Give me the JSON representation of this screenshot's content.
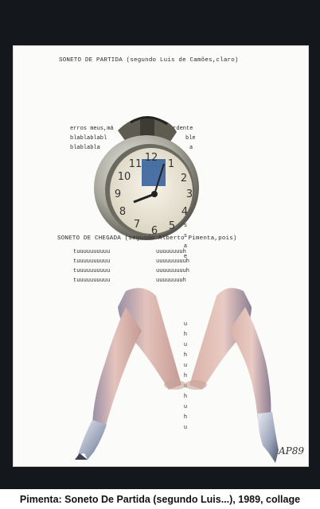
{
  "caption": "Pimenta: Soneto De Partida (segundo Luis...), 1989, collage",
  "poem_top": {
    "title": "SONETO DE PARTIDA (segundo Luis de Camões,claro)",
    "lines": [
      "erros meus,má",
      "blablablabl",
      "blablabla"
    ],
    "right_fragments": [
      "ardente",
      "ble",
      "a"
    ],
    "column": [
      "s",
      "s",
      "a",
      "e",
      "s",
      "a",
      "s"
    ]
  },
  "poem_bottom": {
    "title": "SONETO DE CHEGADA (segundo Alberto Pimenta,pois)",
    "lines": [
      "tuuuuuuuuuu",
      "tuuuuuuuuuu",
      "tuuuuuuuuuu",
      "tuuuuuuuuuu"
    ],
    "right_lines": [
      "uuuuuuuuh",
      "uuuuuuuuuh",
      "uuuuuuuuuh",
      "uuuuuuuuh"
    ],
    "column": [
      "u",
      "h",
      "u",
      "h",
      "u",
      "h",
      "u",
      "h",
      "u",
      "h",
      "u"
    ]
  },
  "clock": {
    "numbers": [
      "12",
      "1",
      "2",
      "3",
      "4",
      "5",
      "6",
      "7",
      "8",
      "9",
      "10",
      "11"
    ]
  },
  "signature": "AP89"
}
